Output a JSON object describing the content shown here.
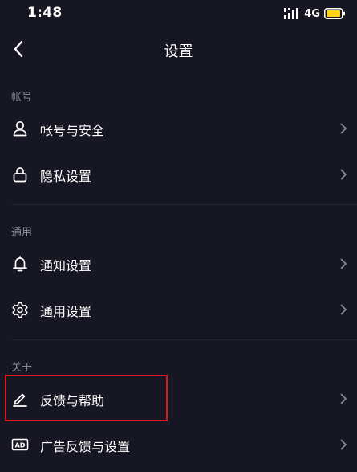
{
  "status_bar": {
    "time": "1:48",
    "network": "4G",
    "battery_color": "#ffd21f"
  },
  "nav": {
    "title": "设置",
    "back_icon": "chevron-left-icon"
  },
  "sections": {
    "account": {
      "header": "帐号",
      "items": [
        {
          "label": "帐号与安全",
          "icon": "user-icon"
        },
        {
          "label": "隐私设置",
          "icon": "lock-icon"
        }
      ]
    },
    "general": {
      "header": "通用",
      "items": [
        {
          "label": "通知设置",
          "icon": "bell-icon"
        },
        {
          "label": "通用设置",
          "icon": "gear-icon"
        }
      ]
    },
    "about": {
      "header": "关于",
      "items": [
        {
          "label": "反馈与帮助",
          "icon": "edit-icon"
        },
        {
          "label": "广告反馈与设置",
          "icon": "ad-icon"
        }
      ]
    }
  },
  "colors": {
    "background": "#161722",
    "section_header": "#8a8b91",
    "chevron": "#8a8b91",
    "highlight": "#e0161f"
  }
}
